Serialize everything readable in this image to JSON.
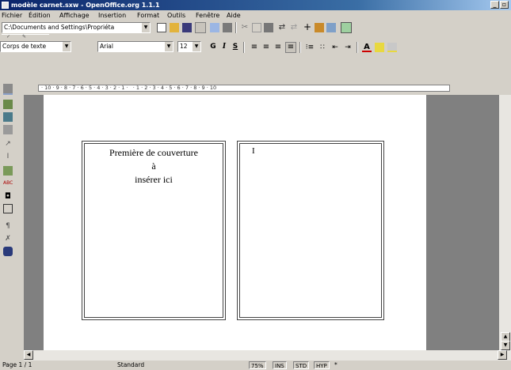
{
  "window": {
    "title": "modèle carnet.sxw - OpenOffice.org 1.1.1"
  },
  "menu": {
    "items": [
      "Fichier",
      "Édition",
      "Affichage",
      "Insertion",
      "Format",
      "Outils",
      "Fenêtre",
      "Aide"
    ]
  },
  "url_combo": {
    "value": "C:\\Documents and Settings\\Propriéta"
  },
  "formatting": {
    "style": "Corps de texte",
    "font": "Arial",
    "size": "12",
    "bold": "G",
    "italic": "I",
    "underline": "S"
  },
  "ruler": {
    "labels": "· 10 · 9 · 8 · 7 · 6 · 5 · 4 · 3 · 2 · 1 ·   · 1 · 2 · 3 · 4 · 5 · 6 · 7 · 8 · 9 · 10"
  },
  "document": {
    "cover_lines": [
      "Première de couverture",
      "à",
      "insérer ici"
    ],
    "right_frame_text": "I"
  },
  "status": {
    "page": "Page 1 / 1",
    "style": "Standard",
    "zoom": "75%",
    "ins": "INS",
    "std": "STD",
    "hyp": "HYP",
    "star": "*"
  }
}
